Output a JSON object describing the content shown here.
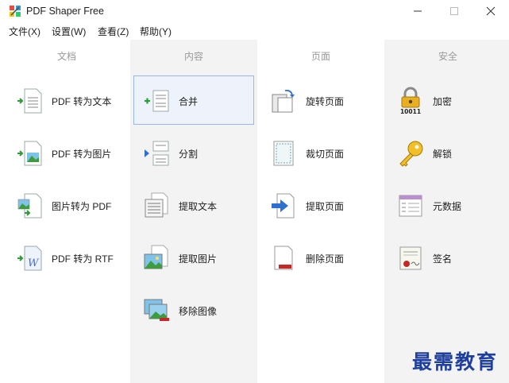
{
  "window": {
    "title": "PDF Shaper Free"
  },
  "menu": [
    "文件(X)",
    "设置(W)",
    "查看(Z)",
    "帮助(Y)"
  ],
  "columns": [
    {
      "header": "文档",
      "tools": [
        {
          "label": "PDF 转为文本",
          "icon": "pdf-to-text-icon"
        },
        {
          "label": "PDF 转为图片",
          "icon": "pdf-to-image-icon"
        },
        {
          "label": "图片转为 PDF",
          "icon": "image-to-pdf-icon"
        },
        {
          "label": "PDF 转为 RTF",
          "icon": "pdf-to-rtf-icon"
        }
      ]
    },
    {
      "header": "内容",
      "tools": [
        {
          "label": "合并",
          "icon": "merge-icon",
          "selected": true
        },
        {
          "label": "分割",
          "icon": "split-icon"
        },
        {
          "label": "提取文本",
          "icon": "extract-text-icon"
        },
        {
          "label": "提取图片",
          "icon": "extract-images-icon"
        },
        {
          "label": "移除图像",
          "icon": "remove-images-icon"
        }
      ]
    },
    {
      "header": "页面",
      "tools": [
        {
          "label": "旋转页面",
          "icon": "rotate-pages-icon"
        },
        {
          "label": "裁切页面",
          "icon": "crop-pages-icon"
        },
        {
          "label": "提取页面",
          "icon": "extract-pages-icon"
        },
        {
          "label": "删除页面",
          "icon": "delete-pages-icon"
        }
      ]
    },
    {
      "header": "安全",
      "tools": [
        {
          "label": "加密",
          "icon": "encrypt-lock-icon"
        },
        {
          "label": "解锁",
          "icon": "decrypt-key-icon"
        },
        {
          "label": "元数据",
          "icon": "metadata-icon"
        },
        {
          "label": "签名",
          "icon": "signature-certificate-icon"
        }
      ]
    }
  ],
  "watermark": "最需教育",
  "colors": {
    "column_alt_bg": "#f3f3f3",
    "selection_bg": "#eef3fb",
    "selection_border": "#9ab8e6",
    "header_text": "#9a9a9a"
  }
}
